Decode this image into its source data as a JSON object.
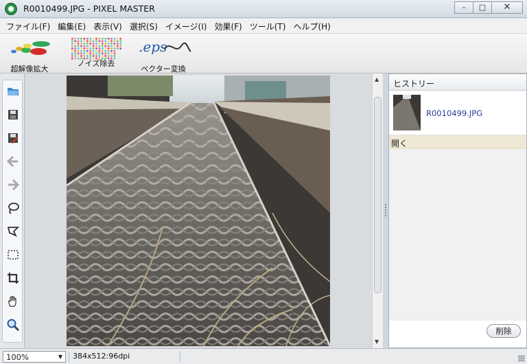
{
  "window": {
    "title": "R0010499.JPG - PIXEL MASTER",
    "minimize": "–",
    "maximize": "□",
    "close": "✕"
  },
  "menu": [
    "ファイル(F)",
    "編集(E)",
    "表示(V)",
    "選択(S)",
    "イメージ(I)",
    "効果(F)",
    "ツール(T)",
    "ヘルプ(H)"
  ],
  "toolbar": {
    "upscale_label": "超解像拡大",
    "denoise_label": "ノイズ除去",
    "vector_label": "ベクター変換",
    "vector_logo_text": ".eps"
  },
  "left_tools": [
    {
      "name": "open-folder-icon"
    },
    {
      "name": "save-icon"
    },
    {
      "name": "save-as-icon"
    },
    {
      "name": "undo-arrow-icon"
    },
    {
      "name": "redo-arrow-icon"
    },
    {
      "name": "lasso-icon"
    },
    {
      "name": "polygon-lasso-icon"
    },
    {
      "name": "rect-select-icon"
    },
    {
      "name": "crop-icon"
    },
    {
      "name": "hand-icon"
    },
    {
      "name": "zoom-icon"
    }
  ],
  "history": {
    "title": "ヒストリー",
    "file_name": "R0010499.JPG",
    "steps": [
      "開く"
    ],
    "delete_label": "削除"
  },
  "status": {
    "zoom": "100%",
    "info": "384x512:96dpi"
  },
  "colors": {
    "history_file": "#2b3d9c",
    "history_selected": "#efe8d6",
    "app_icon": "#2e9a4c"
  }
}
